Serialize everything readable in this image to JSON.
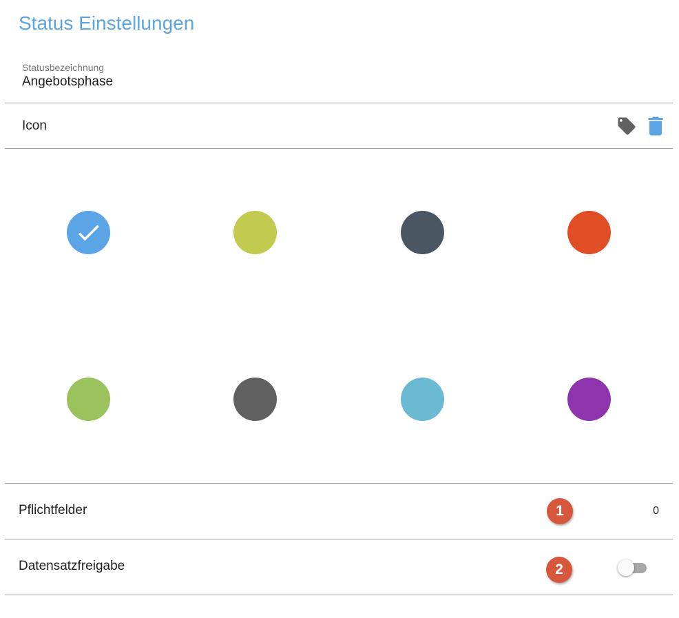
{
  "page": {
    "title": "Status Einstellungen"
  },
  "status_name": {
    "label": "Statusbezeichnung",
    "value": "Angebotsphase"
  },
  "icon_row": {
    "label": "Icon",
    "tag_icon": "tag-icon",
    "delete_icon": "trash-icon",
    "tag_color": "#616161",
    "delete_color": "#5ba4e6"
  },
  "colors": {
    "selected_index": 0,
    "swatches": [
      {
        "color": "#5ba4e6",
        "selected": true
      },
      {
        "color": "#c2ca50",
        "selected": false
      },
      {
        "color": "#4a5662",
        "selected": false
      },
      {
        "color": "#e04e26",
        "selected": false
      },
      {
        "color": "#9ac35e",
        "selected": false
      },
      {
        "color": "#606060",
        "selected": false
      },
      {
        "color": "#6abad2",
        "selected": false
      },
      {
        "color": "#8e34ad",
        "selected": false
      }
    ]
  },
  "required_fields": {
    "label": "Pflichtfelder",
    "badge": "1",
    "count": "0"
  },
  "record_release": {
    "label": "Datensatzfreigabe",
    "badge": "2",
    "enabled": false
  }
}
